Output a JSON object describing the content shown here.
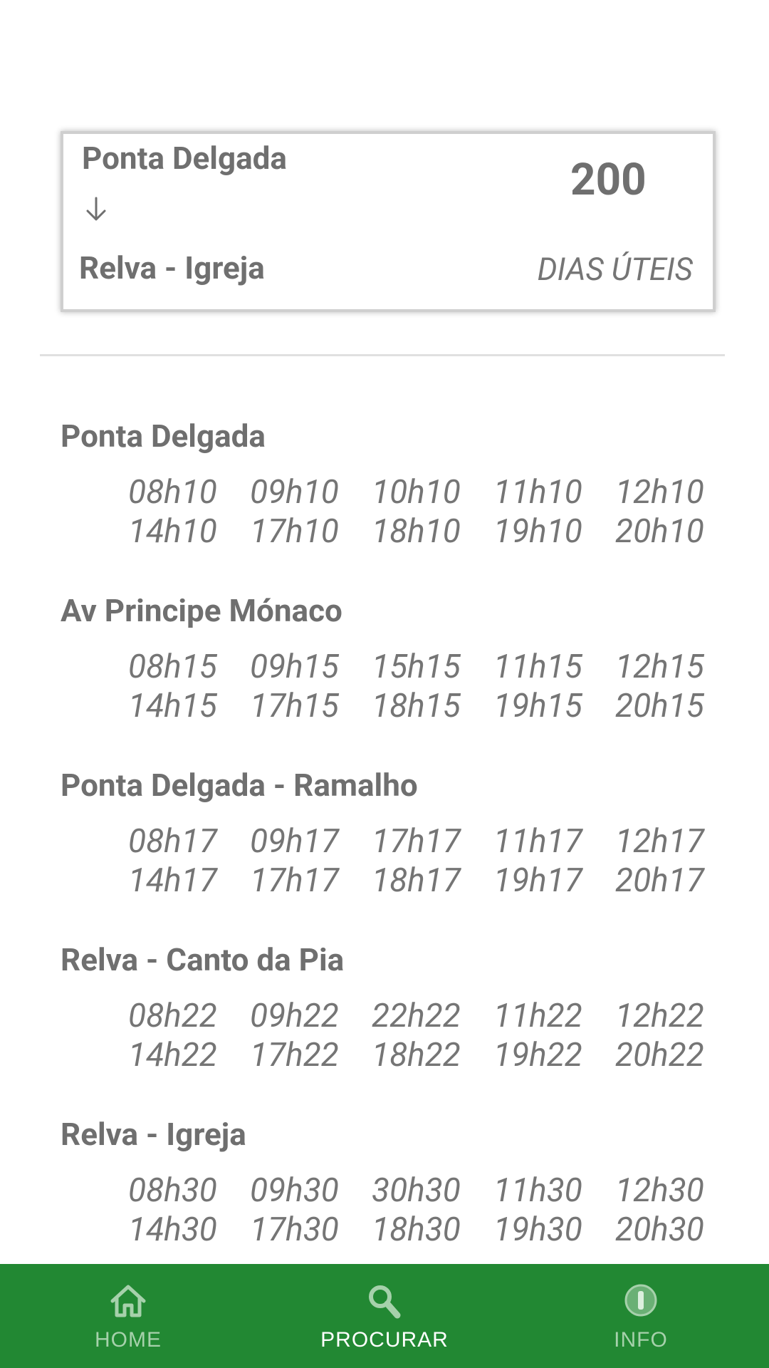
{
  "route": {
    "origin": "Ponta Delgada",
    "destination": "Relva - Igreja",
    "number": "200",
    "day_type": "DIAS ÚTEIS"
  },
  "stops": [
    {
      "name": "Ponta Delgada",
      "times": [
        "08h10",
        "09h10",
        "10h10",
        "11h10",
        "12h10",
        "14h10",
        "17h10",
        "18h10",
        "19h10",
        "20h10"
      ]
    },
    {
      "name": "Av Principe Mónaco",
      "times": [
        "08h15",
        "09h15",
        "15h15",
        "11h15",
        "12h15",
        "14h15",
        "17h15",
        "18h15",
        "19h15",
        "20h15"
      ]
    },
    {
      "name": "Ponta Delgada - Ramalho",
      "times": [
        "08h17",
        "09h17",
        "17h17",
        "11h17",
        "12h17",
        "14h17",
        "17h17",
        "18h17",
        "19h17",
        "20h17"
      ]
    },
    {
      "name": "Relva - Canto da Pia",
      "times": [
        "08h22",
        "09h22",
        "22h22",
        "11h22",
        "12h22",
        "14h22",
        "17h22",
        "18h22",
        "19h22",
        "20h22"
      ]
    },
    {
      "name": "Relva - Igreja",
      "times": [
        "08h30",
        "09h30",
        "30h30",
        "11h30",
        "12h30",
        "14h30",
        "17h30",
        "18h30",
        "19h30",
        "20h30"
      ]
    }
  ],
  "nav": {
    "items": [
      {
        "label": "HOME",
        "icon": "home-icon",
        "active": false
      },
      {
        "label": "PROCURAR",
        "icon": "search-icon",
        "active": true
      },
      {
        "label": "INFO",
        "icon": "info-icon",
        "active": false
      }
    ]
  },
  "colors": {
    "nav_background": "#228833",
    "nav_inactive": "#a6d1ab",
    "nav_active": "#ffffff",
    "text": "#757575"
  }
}
